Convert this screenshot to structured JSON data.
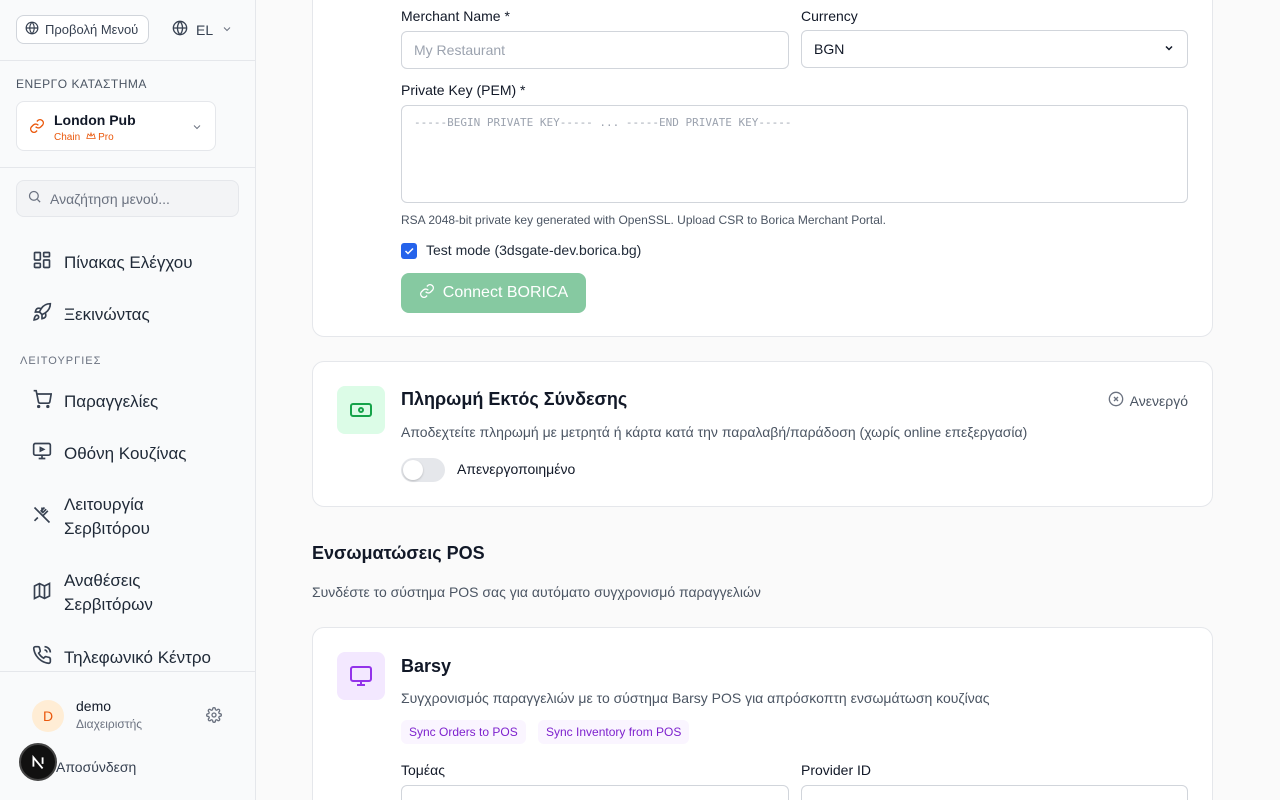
{
  "sidebar": {
    "menu_view_label": "Προβολή Μενού",
    "language": "EL",
    "store_section_label": "ΕΝΕΡΓΟ ΚΑΤΑΣΤΗΜΑ",
    "store": {
      "name": "London Pub",
      "type": "Chain",
      "plan": "Pro"
    },
    "search_placeholder": "Αναζήτηση μενού...",
    "nav_top": [
      {
        "label": "Πίνακας Ελέγχου",
        "icon": "dashboard-icon"
      },
      {
        "label": "Ξεκινώντας",
        "icon": "rocket-icon"
      }
    ],
    "section_label": "ΛΕΙΤΟΥΡΓΙΕΣ",
    "nav_ops": [
      {
        "label": "Παραγγελίες",
        "icon": "cart-icon"
      },
      {
        "label": "Οθόνη Κουζίνας",
        "icon": "monitor-icon"
      },
      {
        "label_line1": "Λειτουργία",
        "label_line2": "Σερβιτόρου",
        "icon": "utensils-icon"
      },
      {
        "label_line1": "Αναθέσεις",
        "label_line2": "Σερβιτόρων",
        "icon": "map-icon"
      },
      {
        "label": "Τηλεφωνικό Κέντρο",
        "icon": "phone-icon"
      }
    ],
    "user": {
      "initial": "D",
      "name": "demo",
      "role": "Διαχειριστής"
    },
    "logout_label": "Αποσύνδεση",
    "badge_letter": "N"
  },
  "borica": {
    "merchant_name_label": "Merchant Name *",
    "merchant_name_placeholder": "My Restaurant",
    "currency_label": "Currency",
    "currency_value": "BGN",
    "private_key_label": "Private Key (PEM) *",
    "private_key_placeholder": "-----BEGIN PRIVATE KEY----- ... -----END PRIVATE KEY-----",
    "hint": "RSA 2048-bit private key generated with OpenSSL. Upload CSR to Borica Merchant Portal.",
    "test_mode_label": "Test mode (3dsgate-dev.borica.bg)",
    "test_mode_checked": true,
    "connect_label": "Connect BORICA"
  },
  "offline_payment": {
    "title": "Πληρωμή Εκτός Σύνδεσης",
    "description": "Αποδεχτείτε πληρωμή με μετρητά ή κάρτα κατά την παραλαβή/παράδοση (χωρίς online επεξεργασία)",
    "status": "Ανενεργό",
    "toggle_label": "Απενεργοποιημένο",
    "enabled": false
  },
  "pos_section": {
    "title": "Ενσωματώσεις POS",
    "description": "Συνδέστε το σύστημα POS σας για αυτόματο συγχρονισμό παραγγελιών"
  },
  "barsy": {
    "title": "Barsy",
    "description": "Συγχρονισμός παραγγελιών με το σύστημα Barsy POS για απρόσκοπτη ενσωμάτωση κουζίνας",
    "tags": [
      "Sync Orders to POS",
      "Sync Inventory from POS"
    ],
    "field1_label": "Τομέας",
    "field2_label": "Provider ID"
  },
  "colors": {
    "accent_green": "#86c9a1",
    "checkbox_blue": "#2563eb",
    "tag_purple": "#7e22ce",
    "chain_orange": "#ea580c"
  }
}
